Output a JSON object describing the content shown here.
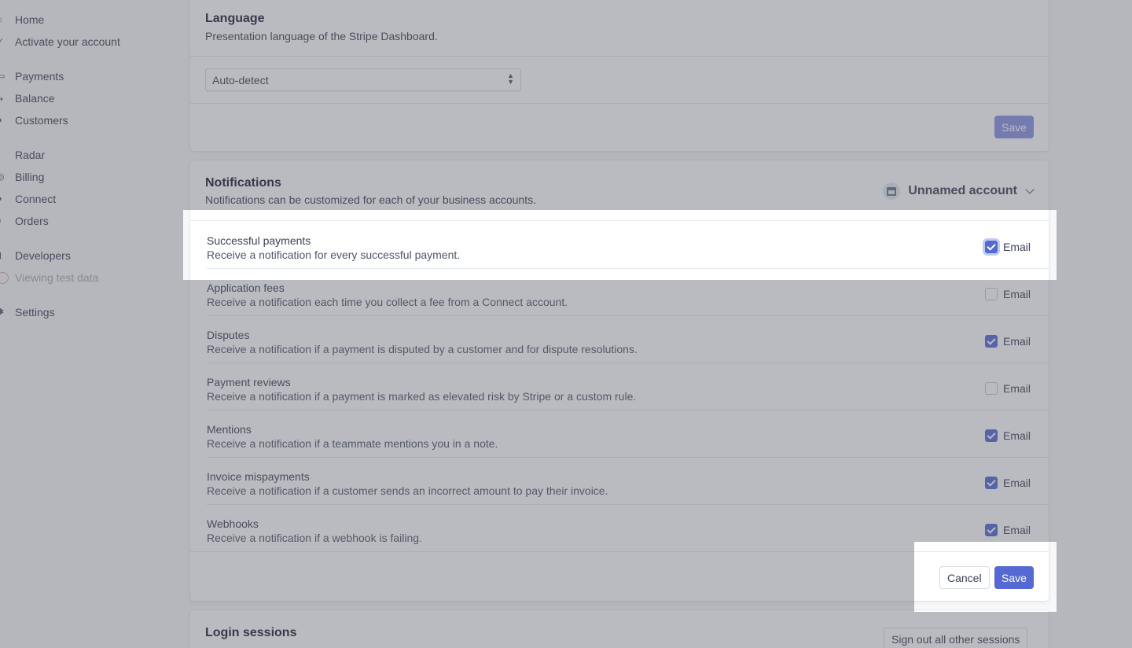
{
  "sidebar": {
    "items": [
      {
        "label": "Home",
        "icon": "home-icon"
      },
      {
        "label": "Activate your account",
        "icon": "check-icon"
      },
      {
        "label": "Payments",
        "icon": "card-icon"
      },
      {
        "label": "Balance",
        "icon": "balance-icon"
      },
      {
        "label": "Customers",
        "icon": "customers-icon"
      },
      {
        "label": "Radar",
        "icon": "radar-icon"
      },
      {
        "label": "Billing",
        "icon": "billing-icon"
      },
      {
        "label": "Connect",
        "icon": "connect-icon"
      },
      {
        "label": "Orders",
        "icon": "orders-icon"
      },
      {
        "label": "Developers",
        "icon": "developers-icon"
      },
      {
        "label": "Viewing test data",
        "icon": "toggle-icon"
      },
      {
        "label": "Settings",
        "icon": "gear-icon"
      }
    ]
  },
  "language": {
    "title": "Language",
    "subtitle": "Presentation language of the Stripe Dashboard.",
    "select_value": "Auto-detect",
    "save_label": "Save"
  },
  "notifications": {
    "title": "Notifications",
    "subtitle": "Notifications can be customized for each of your business accounts.",
    "account_name": "Unnamed account",
    "rows": [
      {
        "title": "Successful payments",
        "description": "Receive a notification for every successful payment.",
        "email_label": "Email",
        "checked": true
      },
      {
        "title": "Application fees",
        "description": "Receive a notification each time you collect a fee from a Connect account.",
        "email_label": "Email",
        "checked": false
      },
      {
        "title": "Disputes",
        "description": "Receive a notification if a payment is disputed by a customer and for dispute resolutions.",
        "email_label": "Email",
        "checked": true
      },
      {
        "title": "Payment reviews",
        "description": "Receive a notification if a payment is marked as elevated risk by Stripe or a custom rule.",
        "email_label": "Email",
        "checked": false
      },
      {
        "title": "Mentions",
        "description": "Receive a notification if a teammate mentions you in a note.",
        "email_label": "Email",
        "checked": true
      },
      {
        "title": "Invoice mispayments",
        "description": "Receive a notification if a customer sends an incorrect amount to pay their invoice.",
        "email_label": "Email",
        "checked": true
      },
      {
        "title": "Webhooks",
        "description": "Receive a notification if a webhook is failing.",
        "email_label": "Email",
        "checked": true
      }
    ],
    "cancel_label": "Cancel",
    "save_label": "Save"
  },
  "login_sessions": {
    "title": "Login sessions",
    "sign_out_label": "Sign out all other sessions"
  }
}
